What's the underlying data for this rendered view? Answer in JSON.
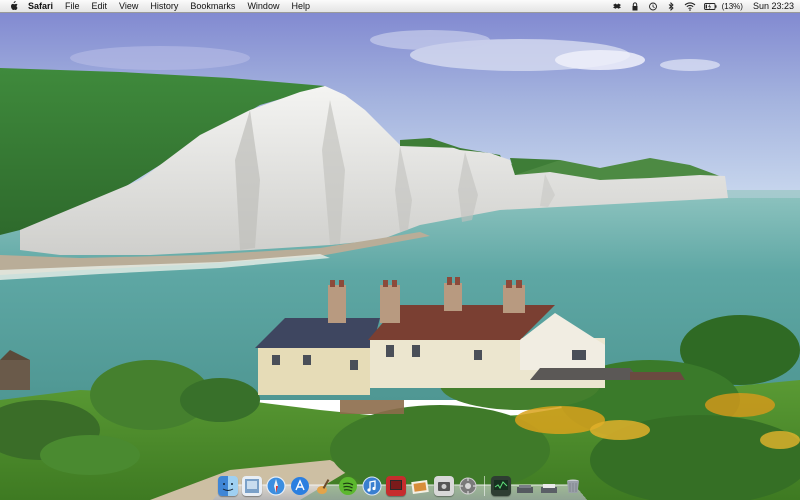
{
  "menubar": {
    "apple_icon": "apple-logo-icon",
    "app_name": "Safari",
    "menus": [
      "File",
      "Edit",
      "View",
      "History",
      "Bookmarks",
      "Window",
      "Help"
    ],
    "status": {
      "icons": [
        "dropbox-icon",
        "lock-icon",
        "time-machine-icon",
        "bluetooth-icon",
        "wifi-icon",
        "battery-icon"
      ],
      "battery_percent": "(13%)",
      "clock": "Sun 23:23"
    }
  },
  "wallpaper": {
    "description_icon": "landscape-wallpaper"
  },
  "dock": {
    "apps": [
      {
        "name": "finder-icon",
        "color": "#4a8fd8"
      },
      {
        "name": "preview-icon",
        "color": "#6c8fb8"
      },
      {
        "name": "safari-icon",
        "color": "#3c8ee0"
      },
      {
        "name": "app-store-icon",
        "color": "#2b7fe0"
      },
      {
        "name": "garageband-icon",
        "color": "#e3a44a"
      },
      {
        "name": "spotify-icon",
        "color": "#5cb82e"
      },
      {
        "name": "itunes-icon",
        "color": "#3a7fd0"
      },
      {
        "name": "photo-booth-icon",
        "color": "#c62d2d"
      },
      {
        "name": "iphoto-icon",
        "color": "#d88d3a"
      },
      {
        "name": "screenshot-icon",
        "color": "#888888"
      },
      {
        "name": "system-preferences-icon",
        "color": "#7a7a7a"
      }
    ],
    "stacks": [
      {
        "name": "activity-monitor-icon",
        "color": "#3c6f4c"
      },
      {
        "name": "documents-stack-icon",
        "color": "#555a60"
      },
      {
        "name": "downloads-stack-icon",
        "color": "#5a5f66"
      },
      {
        "name": "trash-icon",
        "color": "#9aa0a8"
      }
    ]
  }
}
